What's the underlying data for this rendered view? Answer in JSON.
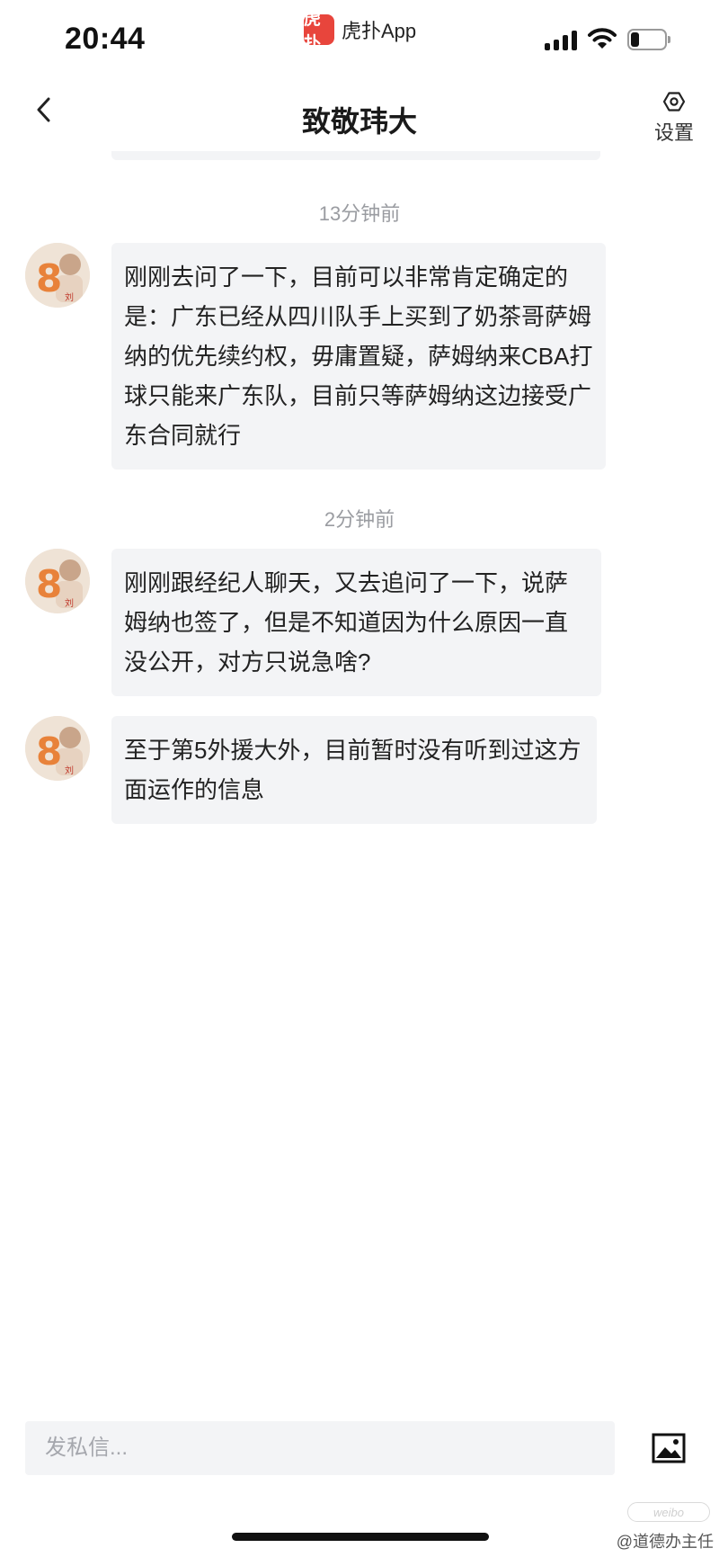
{
  "status_bar": {
    "time": "20:44",
    "app_logo_text": "虎扑",
    "app_name": "虎扑App",
    "battery_level": 0.25
  },
  "header": {
    "title": "致敬玮大",
    "settings_label": "设置"
  },
  "chat": {
    "groups": [
      {
        "timestamp": "13分钟前",
        "messages": [
          {
            "text": "刚刚去问了一下，目前可以非常肯定确定的是：广东已经从四川队手上买到了奶茶哥萨姆纳的优先续约权，毋庸置疑，萨姆纳来CBA打球只能来广东队，目前只等萨姆纳这边接受广东合同就行"
          }
        ]
      },
      {
        "timestamp": "2分钟前",
        "messages": [
          {
            "text": "刚刚跟经纪人聊天，又去追问了一下，说萨姆纳也签了，但是不知道因为什么原因一直没公开，对方只说急啥?"
          },
          {
            "text": "至于第5外援大外，目前暂时没有听到过这方面运作的信息"
          }
        ]
      }
    ]
  },
  "input": {
    "placeholder": "发私信..."
  },
  "watermark": {
    "credit": "@道德办主任"
  },
  "colors": {
    "bubble_bg": "#f3f4f6",
    "brand_red": "#e8453c",
    "timestamp_gray": "#9a9ca1"
  }
}
